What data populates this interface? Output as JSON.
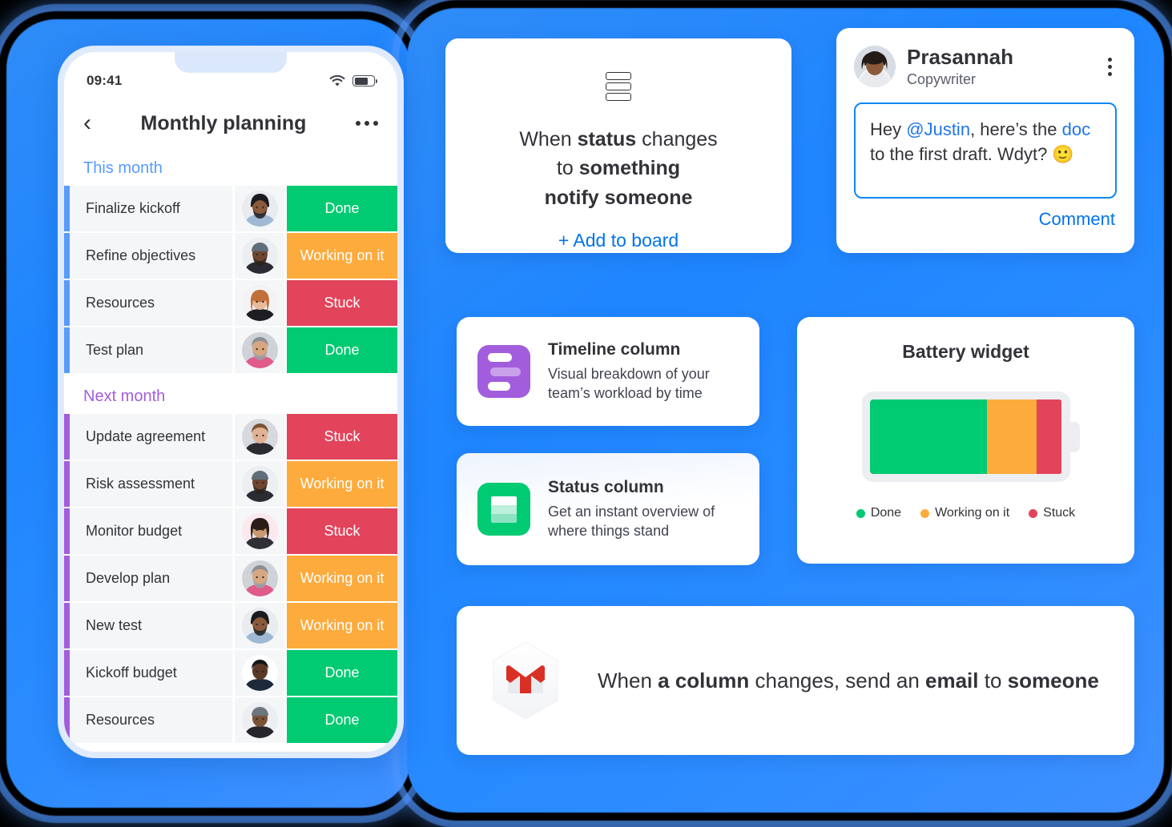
{
  "theme": {
    "accent_blue": "#0073ea",
    "blob_blue": "#1f86ff",
    "done_green": "#00ca72",
    "working_orange": "#fdab3d",
    "stuck_red": "#e2445c",
    "group_blue": "#579bfc",
    "group_purple": "#a25ddc"
  },
  "phone": {
    "status_bar": {
      "time": "09:41",
      "wifi_icon": "wifi-icon",
      "battery_icon": "battery-icon"
    },
    "nav": {
      "back_icon": "chevron-left-icon",
      "title": "Monthly planning",
      "more_icon": "more-horizontal-icon"
    },
    "groups": [
      {
        "title": "This month",
        "color": "#579bfc",
        "rows": [
          {
            "name": "Finalize kickoff",
            "avatar": "avatar-person-1",
            "status": "Done",
            "status_color": "#00ca72"
          },
          {
            "name": "Refine objectives",
            "avatar": "avatar-person-2",
            "status": "Working on it",
            "status_color": "#fdab3d"
          },
          {
            "name": "Resources",
            "avatar": "avatar-person-3",
            "status": "Stuck",
            "status_color": "#e2445c"
          },
          {
            "name": "Test plan",
            "avatar": "avatar-person-4",
            "status": "Done",
            "status_color": "#00ca72"
          }
        ]
      },
      {
        "title": "Next month",
        "color": "#a25ddc",
        "rows": [
          {
            "name": "Update agreement",
            "avatar": "avatar-person-5",
            "status": "Stuck",
            "status_color": "#e2445c"
          },
          {
            "name": "Risk assessment",
            "avatar": "avatar-person-2",
            "status": "Working on it",
            "status_color": "#fdab3d"
          },
          {
            "name": "Monitor budget",
            "avatar": "avatar-person-6",
            "status": "Stuck",
            "status_color": "#e2445c"
          },
          {
            "name": "Develop plan",
            "avatar": "avatar-person-4",
            "status": "Working on it",
            "status_color": "#fdab3d"
          },
          {
            "name": "New test",
            "avatar": "avatar-person-1",
            "status": "Working on it",
            "status_color": "#fdab3d"
          },
          {
            "name": "Kickoff budget",
            "avatar": "avatar-person-7",
            "status": "Done",
            "status_color": "#00ca72"
          },
          {
            "name": "Resources",
            "avatar": "avatar-person-8",
            "status": "Done",
            "status_color": "#00ca72"
          }
        ]
      }
    ]
  },
  "automation_card": {
    "icon": "status-column-rows-icon",
    "line1_plain": "When ",
    "line1_bold": "status",
    "line1_tail": " changes",
    "line2_plain": "to ",
    "line2_bold": "something",
    "line3_bold": "notify someone",
    "add_link": "+ Add to board"
  },
  "comment_card": {
    "avatar": "avatar-prasannah",
    "name": "Prasannah",
    "role": "Copywriter",
    "menu_icon": "more-vertical-icon",
    "message": {
      "pre": "Hey ",
      "mention": "@Justin",
      "mid": ", here’s the ",
      "link": "doc",
      "post": " to the first draft. Wdyt? 🙂"
    },
    "action": "Comment"
  },
  "feature_cards": [
    {
      "icon": "timeline-column-icon",
      "title": "Timeline column",
      "description": "Visual breakdown of your team’s workload by time"
    },
    {
      "icon": "status-column-icon",
      "title": "Status column",
      "description": "Get an instant overview of where things stand"
    }
  ],
  "battery_widget": {
    "title": "Battery widget",
    "icon": "battery-widget-icon"
  },
  "email_card": {
    "icon": "gmail-icon",
    "pre": "When ",
    "bold1": "a column",
    "mid": " changes, send an ",
    "bold2": "email",
    "tail": " to ",
    "bold3": "someone"
  },
  "chart_data": {
    "type": "bar",
    "title": "Battery widget",
    "orientation": "horizontal-stacked",
    "categories": [
      "Done",
      "Working on it",
      "Stuck"
    ],
    "values": [
      61,
      26,
      13
    ],
    "colors": [
      "#00ca72",
      "#fdab3d",
      "#e2445c"
    ],
    "unit": "%",
    "legend_position": "bottom",
    "grid": false,
    "xlabel": "",
    "ylabel": ""
  }
}
